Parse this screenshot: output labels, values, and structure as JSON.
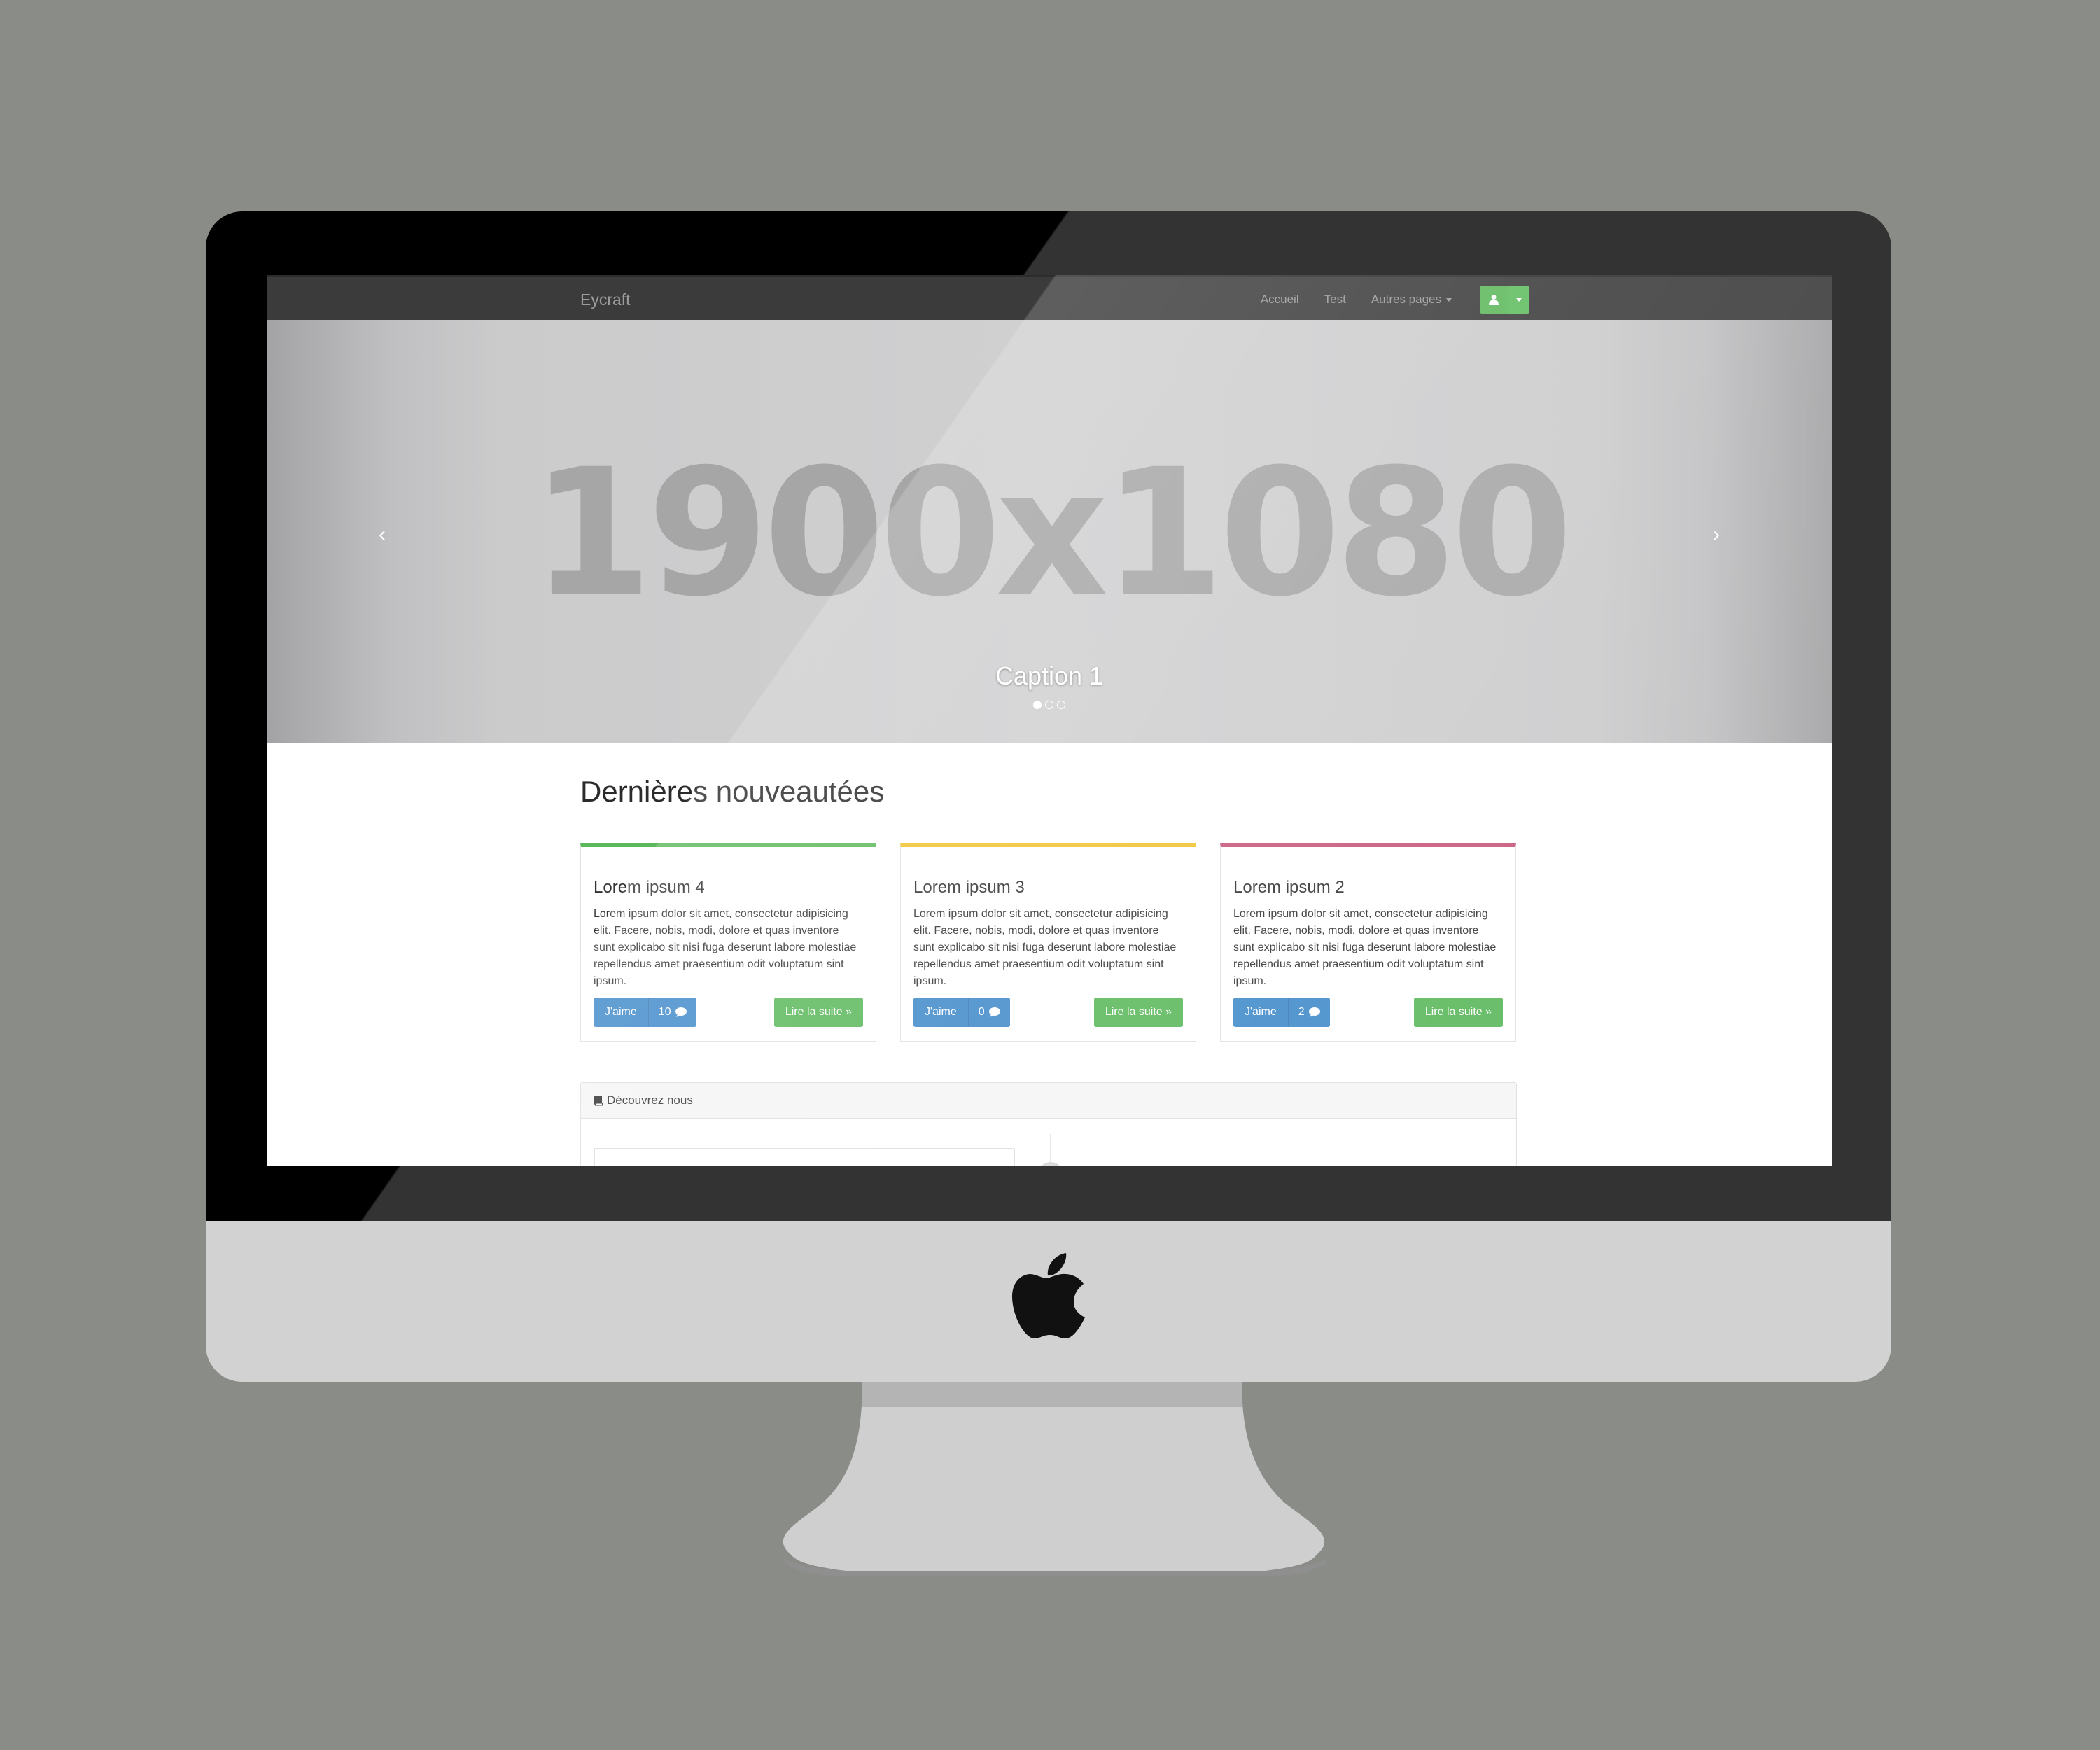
{
  "site": {
    "brand": "Eycraft",
    "nav": {
      "items": [
        {
          "label": "Accueil"
        },
        {
          "label": "Test"
        },
        {
          "label": "Autres pages"
        }
      ]
    },
    "carousel": {
      "slide_text": "1900x1080",
      "caption": "Caption 1",
      "prev_icon": "chevron-left-icon",
      "next_icon": "chevron-right-icon",
      "indicator_count": 3,
      "active_index": 0
    },
    "section_title": "Dernières nouveautées",
    "cards": [
      {
        "title": "Lorem ipsum 4",
        "text": "Lorem ipsum dolor sit amet, consectetur adipisicing elit. Facere, nobis, modi, dolore et quas inventore sunt explicabo sit nisi fuga deserunt labore molestiae repellendus amet praesentium odit voluptatum sint ipsum.",
        "like_label": "J'aime",
        "comments": "10",
        "read_more": "Lire la suite »",
        "accent": "#5cb85c"
      },
      {
        "title": "Lorem ipsum 3",
        "text": "Lorem ipsum dolor sit amet, consectetur adipisicing elit. Facere, nobis, modi, dolore et quas inventore sunt explicabo sit nisi fuga deserunt labore molestiae repellendus amet praesentium odit voluptatum sint ipsum.",
        "like_label": "J'aime",
        "comments": "0",
        "read_more": "Lire la suite »",
        "accent": "#f0c330"
      },
      {
        "title": "Lorem ipsum 2",
        "text": "Lorem ipsum dolor sit amet, consectetur adipisicing elit. Facere, nobis, modi, dolore et quas inventore sunt explicabo sit nisi fuga deserunt labore molestiae repellendus amet praesentium odit voluptatum sint ipsum.",
        "like_label": "J'aime",
        "comments": "2",
        "read_more": "Lire la suite »",
        "accent": "#c9577a"
      }
    ],
    "panel": {
      "title": "Découvrez nous",
      "icon": "book-icon"
    }
  },
  "colors": {
    "navbar": "#3b3b3b",
    "primary": "#428bca",
    "success": "#5cb85c",
    "background": "#8a8c87"
  },
  "device": {
    "logo": "apple-logo-icon"
  }
}
